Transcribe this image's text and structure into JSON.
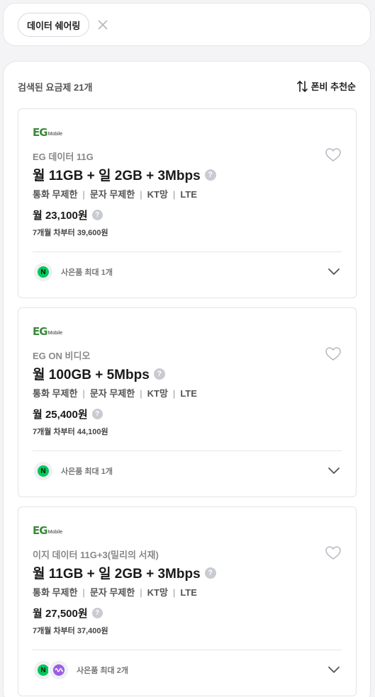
{
  "filter": {
    "chip_label": "데이터 쉐어링"
  },
  "results": {
    "count_label": "검색된 요금제 21개",
    "sort_label": "폰비 추천순"
  },
  "plans": [
    {
      "logo_main": "EG",
      "logo_sub": "Mobile",
      "name": "EG 데이터 11G",
      "data": "월 11GB + 일 2GB + 3Mbps",
      "specs": [
        "통화 무제한",
        "문자 무제한",
        "KT망",
        "LTE"
      ],
      "price": "월 23,100원",
      "discount": "7개월 차부터 39,600원",
      "gift_text": "사은품 최대 1개",
      "gift_icons": [
        "naverpay-icon"
      ]
    },
    {
      "logo_main": "EG",
      "logo_sub": "Mobile",
      "name": "EG ON 비디오",
      "data": "월 100GB + 5Mbps",
      "specs": [
        "통화 무제한",
        "문자 무제한",
        "KT망",
        "LTE"
      ],
      "price": "월 25,400원",
      "discount": "7개월 차부터 44,100원",
      "gift_text": "사은품 최대 1개",
      "gift_icons": [
        "naverpay-icon"
      ]
    },
    {
      "logo_main": "EG",
      "logo_sub": "Mobile",
      "name": "이지 데이터 11G+3(밀리의 서재)",
      "data": "월 11GB + 일 2GB + 3Mbps",
      "specs": [
        "통화 무제한",
        "문자 무제한",
        "KT망",
        "LTE"
      ],
      "price": "월 27,500원",
      "discount": "7개월 차부터 37,400원",
      "gift_text": "사은품 최대 2개",
      "gift_icons": [
        "naverpay-icon",
        "millie-icon"
      ]
    }
  ],
  "colors": {
    "brand_green": "#3a8a3a",
    "naver_green": "#03c75a",
    "millie_purple": "#9b5de5"
  },
  "glyphs": {
    "qmark": "?",
    "naver": "N"
  }
}
